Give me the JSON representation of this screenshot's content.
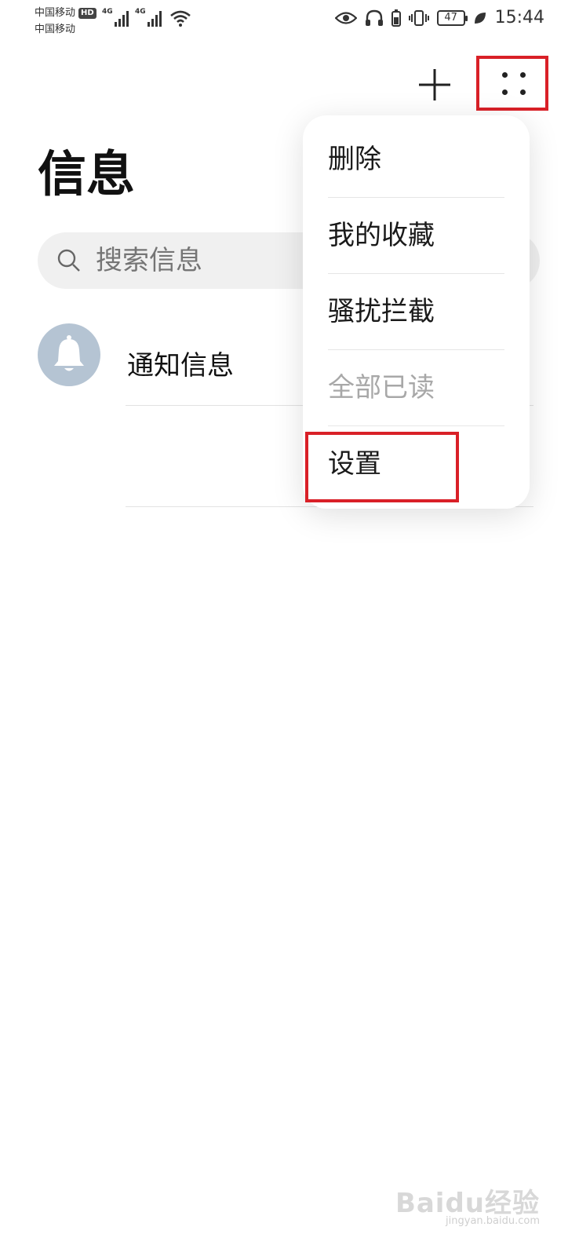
{
  "status_bar": {
    "carrier_1": "中国移动",
    "carrier_2": "中国移动",
    "hd_badge": "HD",
    "network_1": "4G",
    "network_2": "4G",
    "battery": "47",
    "time": "15:44"
  },
  "header": {
    "title": "信息",
    "add_icon": "plus-icon",
    "more_icon": "more-dots-icon"
  },
  "search": {
    "placeholder": "搜索信息"
  },
  "conversations": [
    {
      "title": "通知信息",
      "icon": "bell-icon",
      "avatar_color": "#b5c4d3"
    }
  ],
  "menu": {
    "items": [
      {
        "label": "删除",
        "enabled": true
      },
      {
        "label": "我的收藏",
        "enabled": true
      },
      {
        "label": "骚扰拦截",
        "enabled": true
      },
      {
        "label": "全部已读",
        "enabled": false
      },
      {
        "label": "设置",
        "enabled": true
      }
    ]
  },
  "annotation_color": "#d92027",
  "watermark": {
    "brand": "Baidu经验",
    "url": "jingyan.baidu.com"
  }
}
